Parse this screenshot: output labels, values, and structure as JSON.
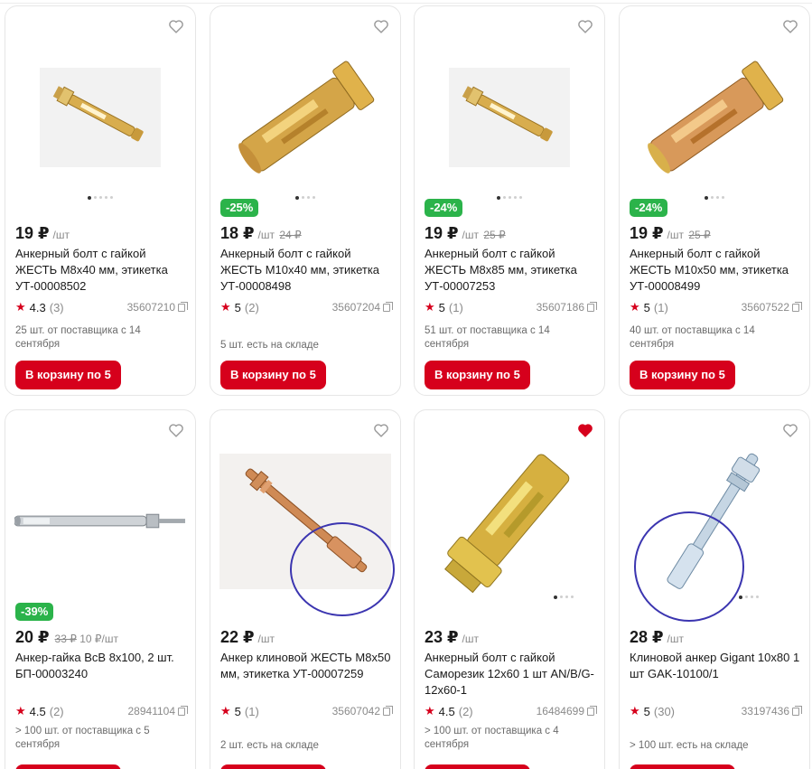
{
  "currency": "₽",
  "cart_label": "В корзину по 5",
  "colors": {
    "accent": "#d6001c",
    "discount": "#2bb34a",
    "favorite_active": "#d6001c"
  },
  "products": [
    {
      "price": "19 ₽",
      "unit": "/шт",
      "old_price": "",
      "discount": "",
      "title": "Анкерный болт с гайкой ЖЕСТЬ М8х40 мм, этикетка УТ-00008502",
      "rating": "4.3",
      "reviews": "(3)",
      "code": "35607210",
      "stock": "25 шт. от поставщика с 14 сентября",
      "favorite": false,
      "icon": "short-anchor-bolt-image"
    },
    {
      "price": "18 ₽",
      "unit": "/шт",
      "old_price": "24 ₽",
      "discount": "-25%",
      "title": "Анкерный болт с гайкой ЖЕСТЬ М10х40 мм, этикетка УТ-00008498",
      "rating": "5",
      "reviews": "(2)",
      "code": "35607204",
      "stock": "5 шт. есть на складе",
      "favorite": false,
      "icon": "sleeve-anchor-image"
    },
    {
      "price": "19 ₽",
      "unit": "/шт",
      "old_price": "25 ₽",
      "discount": "-24%",
      "title": "Анкерный болт с гайкой ЖЕСТЬ М8х85 мм, этикетка УТ-00007253",
      "rating": "5",
      "reviews": "(1)",
      "code": "35607186",
      "stock": "51 шт. от поставщика с 14 сентября",
      "favorite": false,
      "icon": "short-anchor-bolt-image"
    },
    {
      "price": "19 ₽",
      "unit": "/шт",
      "old_price": "25 ₽",
      "discount": "-24%",
      "title": "Анкерный болт с гайкой ЖЕСТЬ М10х50 мм, этикетка УТ-00008499",
      "rating": "5",
      "reviews": "(1)",
      "code": "35607522",
      "stock": "40 шт. от поставщика с 14 сентября",
      "favorite": false,
      "icon": "sleeve-anchor-image"
    },
    {
      "price": "20 ₽",
      "unit": "10 ₽/шт",
      "old_price": "33 ₽",
      "discount": "-39%",
      "title": "Анкер-гайка ВсВ 8х100, 2 шт. БП-00003240",
      "rating": "4.5",
      "reviews": "(2)",
      "code": "28941104",
      "stock": "> 100 шт. от поставщика с 5 сентября",
      "favorite": false,
      "icon": "long-zinc-anchor-image"
    },
    {
      "price": "22 ₽",
      "unit": "/шт",
      "old_price": "",
      "discount": "",
      "title": "Анкер клиновой ЖЕСТЬ М8х50 мм, этикетка УТ-00007259",
      "rating": "5",
      "reviews": "(1)",
      "code": "35607042",
      "stock": "2 шт. есть на складе",
      "favorite": false,
      "icon": "copper-wedge-anchor-image"
    },
    {
      "price": "23 ₽",
      "unit": "/шт",
      "old_price": "",
      "discount": "",
      "title": "Анкерный болт с гайкой Саморезик 12х60 1 шт AN/B/G-12х60-1",
      "rating": "4.5",
      "reviews": "(2)",
      "code": "16484699",
      "stock": "> 100 шт. от поставщика с 4 сентября",
      "favorite": true,
      "icon": "large-sleeve-anchor-image"
    },
    {
      "price": "28 ₽",
      "unit": "/шт",
      "old_price": "",
      "discount": "",
      "title": "Клиновой анкер Gigant 10х80 1 шт GAK-10100/1",
      "rating": "5",
      "reviews": "(30)",
      "code": "33197436",
      "stock": "> 100 шт. есть на складе",
      "favorite": false,
      "icon": "zinc-wedge-anchor-image"
    }
  ]
}
